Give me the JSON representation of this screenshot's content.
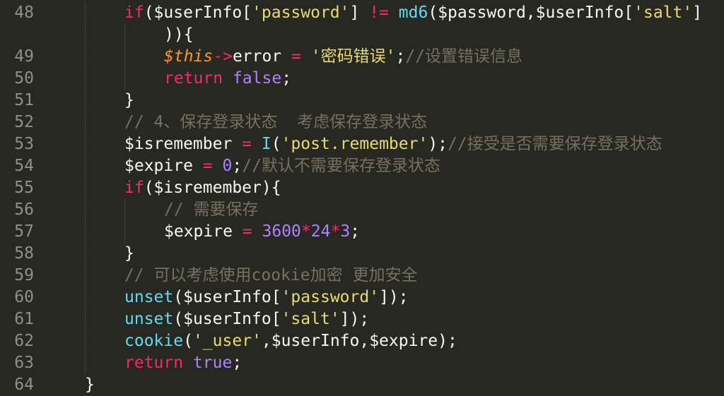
{
  "line_numbers": [
    "48",
    "49",
    "50",
    "51",
    "52",
    "53",
    "54",
    "55",
    "56",
    "57",
    "58",
    "59",
    "60",
    "61",
    "62",
    "63",
    "64"
  ],
  "lines": [
    {
      "indent": 176,
      "tokens": [
        {
          "t": "kw",
          "v": "if"
        },
        {
          "t": "pl",
          "v": "($userInfo["
        },
        {
          "t": "str",
          "v": "'password'"
        },
        {
          "t": "pl",
          "v": "] "
        },
        {
          "t": "op",
          "v": "!="
        },
        {
          "t": "pl",
          "v": " "
        },
        {
          "t": "fn",
          "v": "md6"
        },
        {
          "t": "pl",
          "v": "($password,$userInfo["
        },
        {
          "t": "str",
          "v": "'salt'"
        },
        {
          "t": "pl",
          "v": "]"
        }
      ]
    },
    {
      "indent": 232,
      "tokens": [
        {
          "t": "pl",
          "v": "))"
        },
        {
          "t": "pl",
          "v": "{"
        }
      ]
    },
    {
      "indent": 232,
      "tokens": [
        {
          "t": "this",
          "v": "$this"
        },
        {
          "t": "op",
          "v": "->"
        },
        {
          "t": "pl",
          "v": "error "
        },
        {
          "t": "op",
          "v": "="
        },
        {
          "t": "pl",
          "v": " "
        },
        {
          "t": "str",
          "v": "'密码错误'"
        },
        {
          "t": "pl",
          "v": ";"
        },
        {
          "t": "cm",
          "v": "//设置错误信息"
        }
      ]
    },
    {
      "indent": 232,
      "tokens": [
        {
          "t": "kw",
          "v": "return"
        },
        {
          "t": "pl",
          "v": " "
        },
        {
          "t": "num",
          "v": "false"
        },
        {
          "t": "pl",
          "v": ";"
        }
      ]
    },
    {
      "indent": 176,
      "tokens": [
        {
          "t": "pl",
          "v": "}"
        }
      ]
    },
    {
      "indent": 176,
      "tokens": [
        {
          "t": "cm",
          "v": "// 4、保存登录状态  考虑保存登录状态"
        }
      ]
    },
    {
      "indent": 176,
      "tokens": [
        {
          "t": "pl",
          "v": "$isremember "
        },
        {
          "t": "op",
          "v": "="
        },
        {
          "t": "pl",
          "v": " "
        },
        {
          "t": "fn",
          "v": "I"
        },
        {
          "t": "pl",
          "v": "("
        },
        {
          "t": "str",
          "v": "'post.remember'"
        },
        {
          "t": "pl",
          "v": ");"
        },
        {
          "t": "cm",
          "v": "//接受是否需要保存登录状态"
        }
      ]
    },
    {
      "indent": 176,
      "tokens": [
        {
          "t": "pl",
          "v": "$expire "
        },
        {
          "t": "op",
          "v": "="
        },
        {
          "t": "pl",
          "v": " "
        },
        {
          "t": "num",
          "v": "0"
        },
        {
          "t": "pl",
          "v": ";"
        },
        {
          "t": "cm",
          "v": "//默认不需要保存登录状态"
        }
      ]
    },
    {
      "indent": 176,
      "tokens": [
        {
          "t": "kw",
          "v": "if"
        },
        {
          "t": "pl",
          "v": "($isremember){"
        }
      ]
    },
    {
      "indent": 232,
      "tokens": [
        {
          "t": "cm",
          "v": "// 需要保存"
        }
      ]
    },
    {
      "indent": 232,
      "tokens": [
        {
          "t": "pl",
          "v": "$expire "
        },
        {
          "t": "op",
          "v": "="
        },
        {
          "t": "pl",
          "v": " "
        },
        {
          "t": "num",
          "v": "3600"
        },
        {
          "t": "op",
          "v": "*"
        },
        {
          "t": "num",
          "v": "24"
        },
        {
          "t": "op",
          "v": "*"
        },
        {
          "t": "num",
          "v": "3"
        },
        {
          "t": "pl",
          "v": ";"
        }
      ]
    },
    {
      "indent": 176,
      "tokens": [
        {
          "t": "pl",
          "v": "}"
        }
      ]
    },
    {
      "indent": 176,
      "tokens": [
        {
          "t": "cm",
          "v": "// 可以考虑使用cookie加密 更加安全"
        }
      ]
    },
    {
      "indent": 176,
      "tokens": [
        {
          "t": "fn",
          "v": "unset"
        },
        {
          "t": "pl",
          "v": "($userInfo["
        },
        {
          "t": "str",
          "v": "'password'"
        },
        {
          "t": "pl",
          "v": "]);"
        }
      ]
    },
    {
      "indent": 176,
      "tokens": [
        {
          "t": "fn",
          "v": "unset"
        },
        {
          "t": "pl",
          "v": "($userInfo["
        },
        {
          "t": "str",
          "v": "'salt'"
        },
        {
          "t": "pl",
          "v": "]);"
        }
      ]
    },
    {
      "indent": 176,
      "tokens": [
        {
          "t": "fn",
          "v": "cookie"
        },
        {
          "t": "pl",
          "v": "("
        },
        {
          "t": "str",
          "v": "'_user'"
        },
        {
          "t": "pl",
          "v": ",$userInfo,$expire);"
        }
      ]
    },
    {
      "indent": 176,
      "tokens": [
        {
          "t": "kw",
          "v": "return"
        },
        {
          "t": "pl",
          "v": " "
        },
        {
          "t": "num",
          "v": "true"
        },
        {
          "t": "pl",
          "v": ";"
        }
      ]
    },
    {
      "indent": 120,
      "tokens": [
        {
          "t": "pl",
          "v": "}"
        }
      ]
    }
  ],
  "line_number_map": [
    0,
    null,
    1,
    2,
    3,
    4,
    5,
    6,
    7,
    8,
    9,
    10,
    11,
    12,
    13,
    14,
    15,
    16
  ],
  "theme": {
    "background": "#272822",
    "keyword": "#f92672",
    "function": "#66d9ef",
    "string": "#e6db74",
    "number": "#ae81ff",
    "this": "#fd971f",
    "comment": "#75715e",
    "plain": "#f8f8f2",
    "gutter_text": "#8f908a"
  }
}
